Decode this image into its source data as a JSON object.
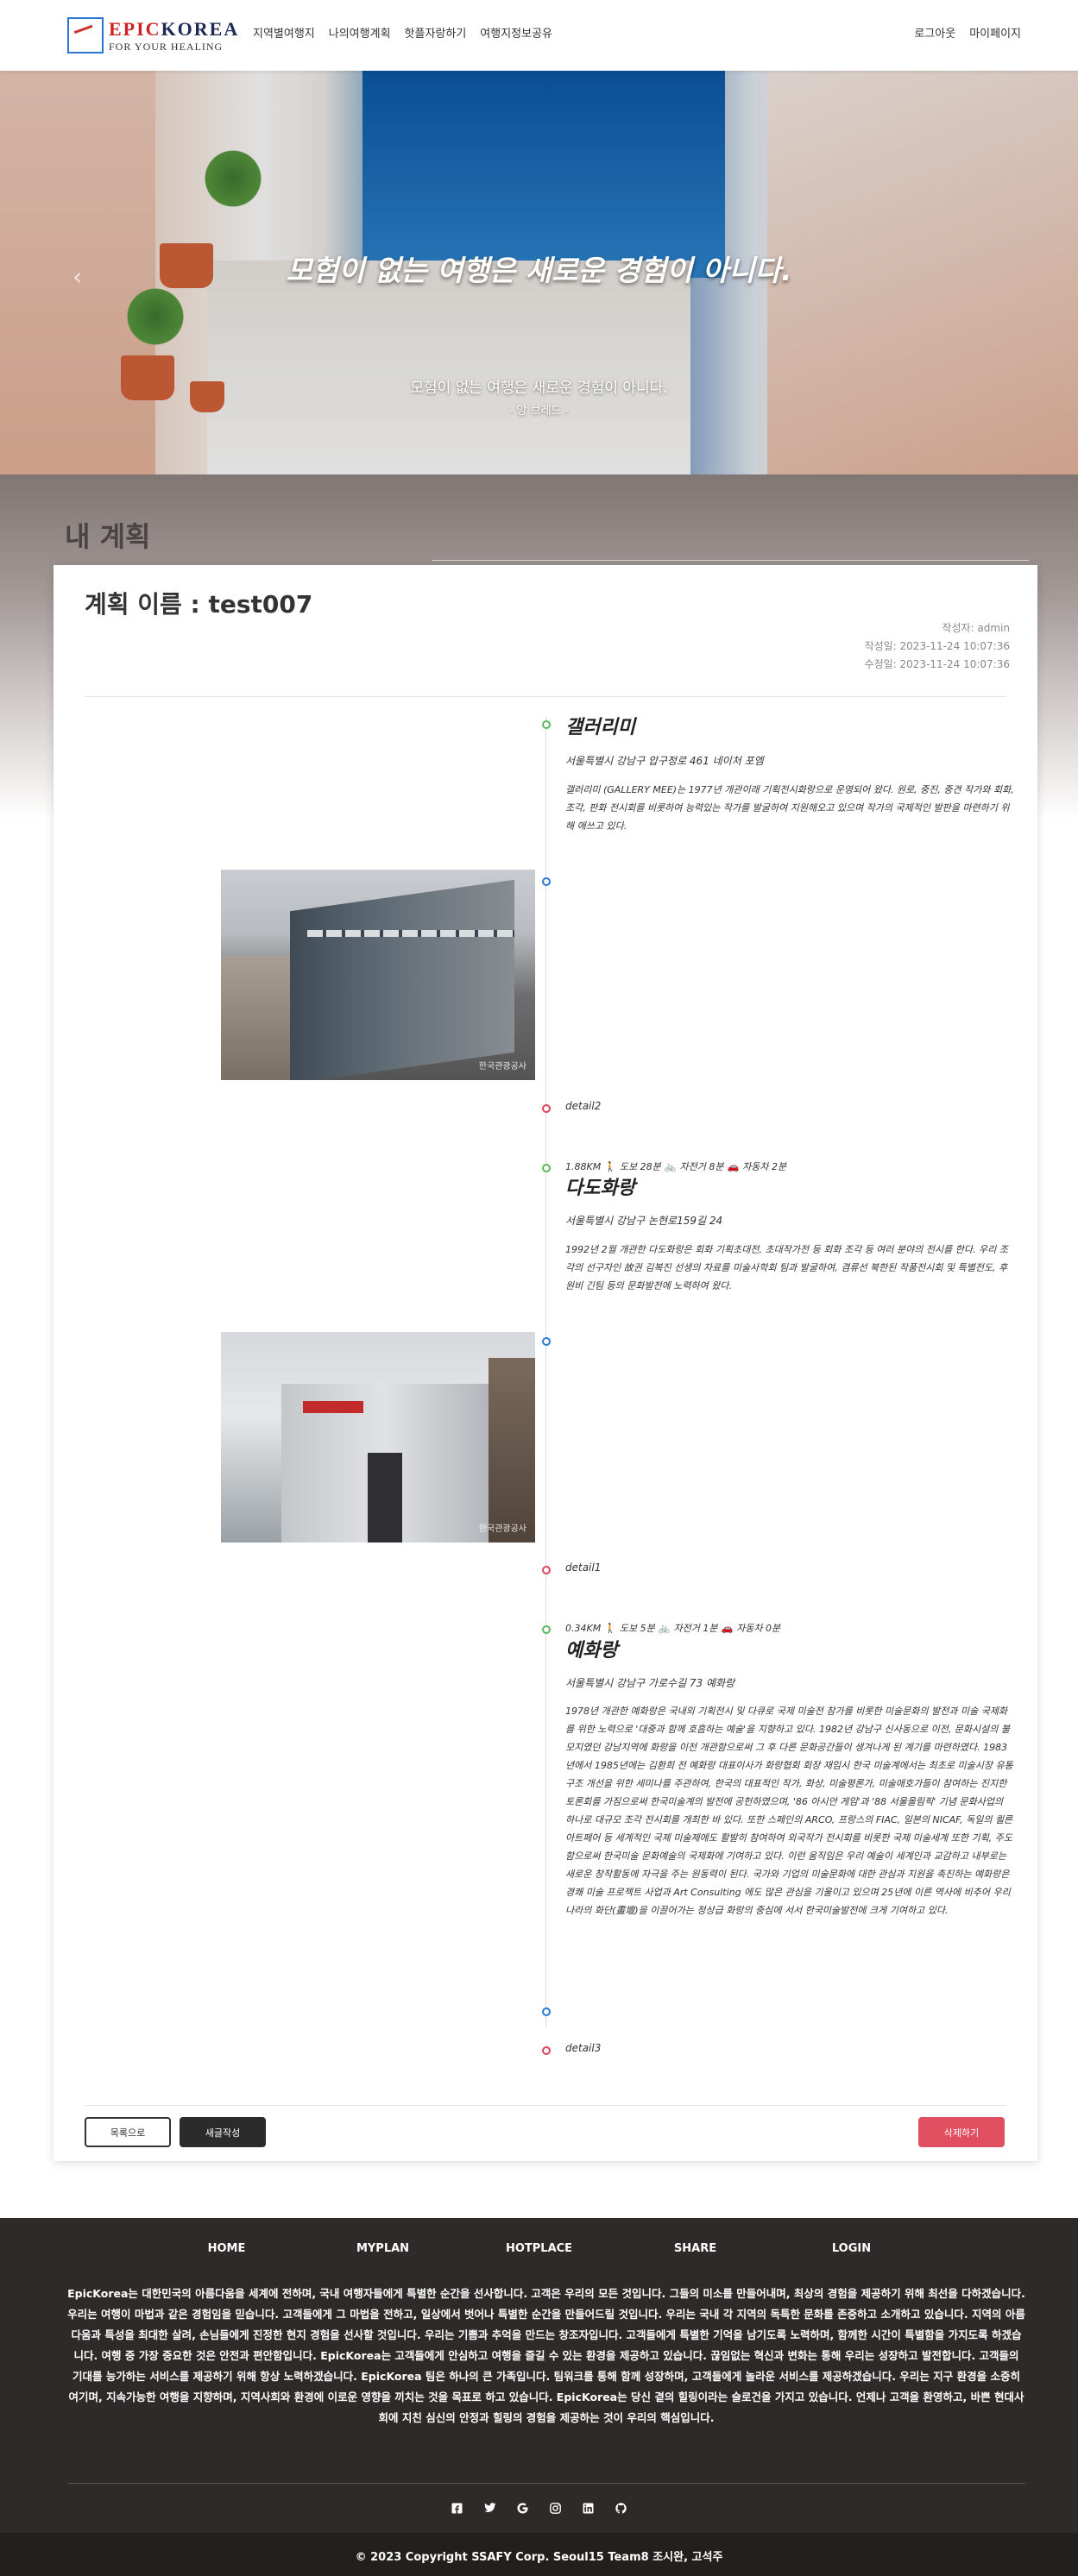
{
  "nav": {
    "logo_epic": "EPIC",
    "logo_korea": "KOREA",
    "logo_sub": "FOR YOUR HEALING",
    "links": [
      "지역별여행지",
      "나의여행계획",
      "핫플자랑하기",
      "여행지정보공유"
    ],
    "right_links": [
      "로그아웃",
      "마이페이지"
    ]
  },
  "hero": {
    "title": "모험이 없는 여행은 새로운 경험이 아니다.",
    "quote": "모험이 없는 여행은 새로운 경험이 아니다.",
    "author": "- 앙 브레드 -",
    "prev_arrow": "‹"
  },
  "plan": {
    "heading": "내 계획",
    "title": "계획 이름 : test007",
    "author": "작성자: admin",
    "created": "작성일: 2023-11-24 10:07:36",
    "updated": "수정일: 2023-11-24 10:07:36"
  },
  "timeline": [
    {
      "name": "갤러리미",
      "address": "서울특별시 강남구 압구정로 461 네이처 포엠",
      "description": "갤러리미 (GALLERY MEE)는 1977년 개관이래 기획전시화랑으로 운영되어 왔다. 원로, 중진, 중견 작가와 회화, 조각, 판화 전시회를 비롯하여 능력있는 작가를 발굴하여 지원해오고 있으며 작가의 국제적인 발판을 마련하기 위해 애쓰고 있다.",
      "detail": "detail2"
    },
    {
      "distance": "1.88KM",
      "walk": "도보 28분",
      "bike": "자전거 8분",
      "car": "자동차 2분",
      "name": "다도화랑",
      "address": "서울특별시 강남구 논현로159길 24",
      "description": "1992년 2월 개관한 다도화랑은 회화 기획초대전, 초대작가전 등 회화 조각 등 여러 분야의 전시를 한다. 우리 조각의 선구자인 故권 김복진 선생의 자료를 미술사학회 팀과 발굴하여, 겸류선 북한된 작품전시회 및 특별전도, 후원비 긴팀 등의 문화발전에 노력하여 왔다.",
      "detail": "detail1"
    },
    {
      "distance": "0.34KM",
      "walk": "도보 5분",
      "bike": "자전거 1분",
      "car": "자동차 0분",
      "name": "예화랑",
      "address": "서울특별시 강남구 가로수길 73 예화랑",
      "description": "1978년 개관한 예화랑은 국내외 기획전시 및 다큐로 국제 미술전 참가를 비롯한 미술문화의 발전과 미술 국제화를 위한 노력으로 '대중과 함께 호흡하는 예술'을 지향하고 있다. 1982년 강남구 신사동으로 이전, 문화시설의 불모지였던 강남지역에 화랑을 이전 개관함으로써 그 후 다른 문화공간들이 생겨나게 된 계기를 마련하였다. 1983년에서 1985년에는 김환희 전 예화랑 대표이사가 화랑협회 회장 재임시 한국 미술계에서는 최초로 미술시장 유통구조 개선을 위한 세미나를 주관하여, 한국의 대표적인 작가, 화상, 미술평론가, 미술애호가들이 참여하는 진지한 토론회를 가짐으로써 한국미술계의 발전에 공헌하였으며, '86 아시안 게임'과 '88 서울올림픽' 기념 문화사업의 하나로 대규모 조각 전시회를 개최한 바 있다. 또한 스페인의 ARCO, 프랑스의 FIAC, 일본의 NICAF, 독일의 쾰른아트페어 등 세계적인 국제 미술제에도 활발히 참여하여 외국작가 전시회를 비롯한 국제 미술세계 또한 기획, 주도함으로써 한국미술 문화예술의 국제화에 기여하고 있다. 이런 움직임은 우리 예술이 세계인과 교감하고 내부로는 새로운 창작활동에 자극을 주는 원동력이 된다. 국가와 기업의 미술문화에 대한 관심과 지원을 촉진하는 예화랑은 경쾌 미술 프로젝트 사업과 Art Consulting 에도 많은 관심을 기울이고 있으며 25년에 이른 역사에 비추어 우리나라의 화단(畫壇)을 이끌어가는 정상급 화랑의 중심에 서서 한국미술발전에 크게 기여하고 있다.",
      "detail": "detail3"
    }
  ],
  "buttons": {
    "list": "목록으로",
    "write": "새글작성",
    "delete": "삭제하기"
  },
  "photos": {
    "watermark": "한국관광공사"
  },
  "footer": {
    "links": [
      "HOME",
      "MYPLAN",
      "HOTPLACE",
      "SHARE",
      "LOGIN"
    ],
    "text": "EpicKorea는 대한민국의 아름다움을 세계에 전하며, 국내 여행자들에게 특별한 순간을 선사합니다. 고객은 우리의 모든 것입니다. 그들의 미소를 만들어내며, 최상의 경험을 제공하기 위해 최선을 다하겠습니다. 우리는 여행이 마법과 같은 경험임을 믿습니다. 고객들에게 그 마법을 전하고, 일상에서 벗어나 특별한 순간을 만들어드릴 것입니다. 우리는 국내 각 지역의 독특한 문화를 존중하고 소개하고 있습니다. 지역의 아름다움과 특성을 최대한 살려, 손님들에게 진정한 현지 경험을 선사할 것입니다. 우리는 기쁨과 추억을 만드는 창조자입니다. 고객들에게 특별한 기억을 남기도록 노력하며, 함께한 시간이 특별함을 가지도록 하겠습니다. 여행 중 가장 중요한 것은 안전과 편안함입니다. EpicKorea는 고객들에게 안심하고 여행을 즐길 수 있는 환경을 제공하고 있습니다. 끊임없는 혁신과 변화는 통해 우리는 성장하고 발전합니다. 고객들의 기대를 능가하는 서비스를 제공하기 위해 항상 노력하겠습니다. EpicKorea 팀은 하나의 큰 가족입니다. 팀워크를 통해 함께 성장하며, 고객들에게 놀라운 서비스를 제공하겠습니다. 우리는 지구 환경을 소중히 여기며, 지속가능한 여행을 지향하며, 지역사회와 환경에 이로운 영향을 끼치는 것을 목표로 하고 있습니다. EpicKorea는 당신 곁의 힐링이라는 슬로건을 가지고 있습니다. 언제나 고객을 환영하고, 바쁜 현대사회에 지친 심신의 안정과 힐링의 경험을 제공하는 것이 우리의 핵심입니다.",
    "icons": [
      "facebook-icon",
      "twitter-icon",
      "google-icon",
      "instagram-icon",
      "linkedin-icon",
      "github-icon"
    ],
    "copyright": "© 2023 Copyright SSAFY Corp. Seoul15 Team8 조시완, 고석주"
  },
  "colors": {
    "accent_red": "#e04e60",
    "timeline_green": "#5cb85c",
    "timeline_blue": "#2a7ad9",
    "footer_bg": "#2f2a2a"
  }
}
